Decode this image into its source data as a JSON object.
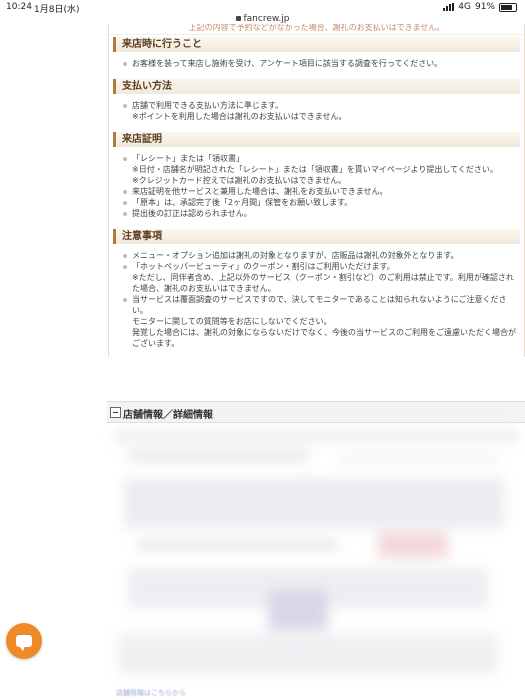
{
  "status": {
    "time": "10:24",
    "date": "1月8日(水)",
    "network": "4G",
    "battery": "91%"
  },
  "url": {
    "host": "fancrew.jp"
  },
  "top_partial": "上記の内容で予約などがなかった場合、謝礼のお支払いはできません。",
  "sections": [
    {
      "title": "来店時に行うこと",
      "lines": [
        {
          "kind": "bullet",
          "text": "お客様を装って来店し施術を受け、アンケート項目に該当する調査を行ってください。"
        }
      ]
    },
    {
      "title": "支払い方法",
      "lines": [
        {
          "kind": "bullet",
          "text": "店舗で利用できる支払い方法に準じます。"
        },
        {
          "kind": "note",
          "text": "※ポイントを利用した場合は謝礼のお支払いはできません。"
        }
      ]
    },
    {
      "title": "来店証明",
      "lines": [
        {
          "kind": "bullet",
          "text": "「レシート」または「領収書」"
        },
        {
          "kind": "note",
          "text": "※日付・店舗名が明記された「レシート」または「領収書」を貰いマイページより提出してください。"
        },
        {
          "kind": "note",
          "text": "※クレジットカード控えでは謝礼のお支払いはできません。"
        },
        {
          "kind": "bullet",
          "text": "来店証明を他サービスと兼用した場合は、謝礼をお支払いできません。"
        },
        {
          "kind": "bullet",
          "text": "「原本」は、承認完了後「2ヶ月間」保管をお願い致します。"
        },
        {
          "kind": "bullet",
          "text": "提出後の訂正は認められません。"
        }
      ]
    },
    {
      "title": "注意事項",
      "lines": [
        {
          "kind": "bullet",
          "text": "メニュー・オプション追加は謝礼の対象となりますが、店販品は謝礼の対象外となります。"
        },
        {
          "kind": "bullet",
          "text": "「ホットペッパービューティ」のクーポン・割引はご利用いただけます。"
        },
        {
          "kind": "note",
          "text": "※ただし、同伴者含め、上記以外のサービス（クーポン・割引など）のご利用は禁止です。利用が確認された場合、謝礼のお支払いはできません。"
        },
        {
          "kind": "bullet",
          "text": "当サービスは覆面調査のサービスですので、決してモニターであることは知られないようにご注意ください。"
        },
        {
          "kind": "cont",
          "text": "モニターに関しての質問等をお店にしないでください。"
        },
        {
          "kind": "cont",
          "text": "発覚した場合には、謝礼の対象にならないだけでなく、今後の当サービスのご利用をご遠慮いただく場合がございます。"
        }
      ]
    }
  ],
  "store_section": {
    "title": "店舗情報／詳細情報"
  },
  "footer_link": "店舗情報はこちらから"
}
